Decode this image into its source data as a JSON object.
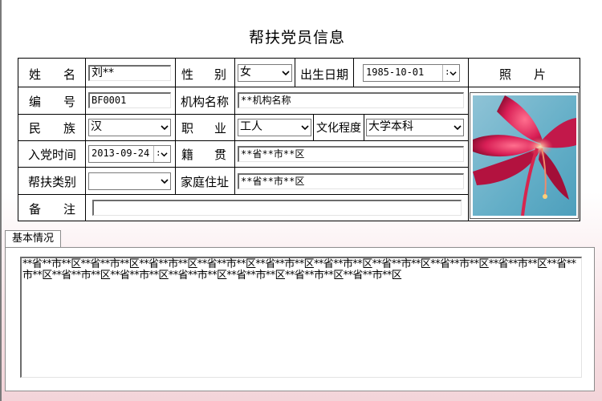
{
  "title": "帮扶党员信息",
  "labels": {
    "name": [
      "姓",
      "名"
    ],
    "gender": [
      "性",
      "别"
    ],
    "birthdate": "出生日期",
    "photo": [
      "照",
      "片"
    ],
    "number": [
      "编",
      "号"
    ],
    "org_name": "机构名称",
    "ethnicity": [
      "民",
      "族"
    ],
    "occupation": [
      "职",
      "业"
    ],
    "education": "文化程度",
    "join_date": "入党时间",
    "native_place": [
      "籍",
      "贯"
    ],
    "assist_type": "帮扶类别",
    "home_address": "家庭住址",
    "remark": [
      "备",
      "注"
    ]
  },
  "fields": {
    "name": "刘**",
    "gender": "女",
    "birthdate": "1985-10-01",
    "number": "BF0001",
    "org_name": "**机构名称",
    "ethnicity": "汉",
    "occupation": "工人",
    "education": "大学本科",
    "join_date": "2013-09-24",
    "native_place": "**省**市**区",
    "assist_type": "",
    "home_address": "**省**市**区",
    "remark": ""
  },
  "tab": {
    "label": "基本情况"
  },
  "memo": {
    "text": "**省**市**区**省**市**区**省**市**区**省**市**区**省**市**区**省**市**区**省**市**区**省**市**区**省**市**区**省**市**区**省**市**区**省**市**区**省**市**区**省**市**区**省**市**区**省**市**区"
  },
  "icons": {
    "dropdown": "chevron-down-icon",
    "photo": "flower-photo"
  }
}
